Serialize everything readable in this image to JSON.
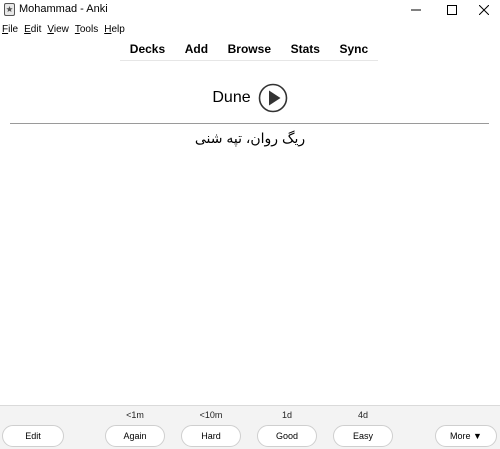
{
  "window": {
    "title": "Mohammad - Anki"
  },
  "menu": [
    {
      "label": "File",
      "mnemonic": "F",
      "rest": "ile"
    },
    {
      "label": "Edit",
      "mnemonic": "E",
      "rest": "dit"
    },
    {
      "label": "View",
      "mnemonic": "V",
      "rest": "iew"
    },
    {
      "label": "Tools",
      "mnemonic": "T",
      "rest": "ools"
    },
    {
      "label": "Help",
      "mnemonic": "H",
      "rest": "elp"
    }
  ],
  "toolbar": {
    "decks": "Decks",
    "add": "Add",
    "browse": "Browse",
    "stats": "Stats",
    "sync": "Sync"
  },
  "card": {
    "question": "Dune",
    "answer": "ریگ روان، تپه شنی"
  },
  "bottom": {
    "edit_label": "Edit",
    "more_label": "More ▼",
    "answer_buttons": [
      {
        "label": "Again",
        "interval": "<1m"
      },
      {
        "label": "Hard",
        "interval": "<10m"
      },
      {
        "label": "Good",
        "interval": "1d"
      },
      {
        "label": "Easy",
        "interval": "4d"
      }
    ]
  },
  "colors": {
    "divider": "#9a9a9a",
    "bottom_bar": "#f3f3f3"
  }
}
